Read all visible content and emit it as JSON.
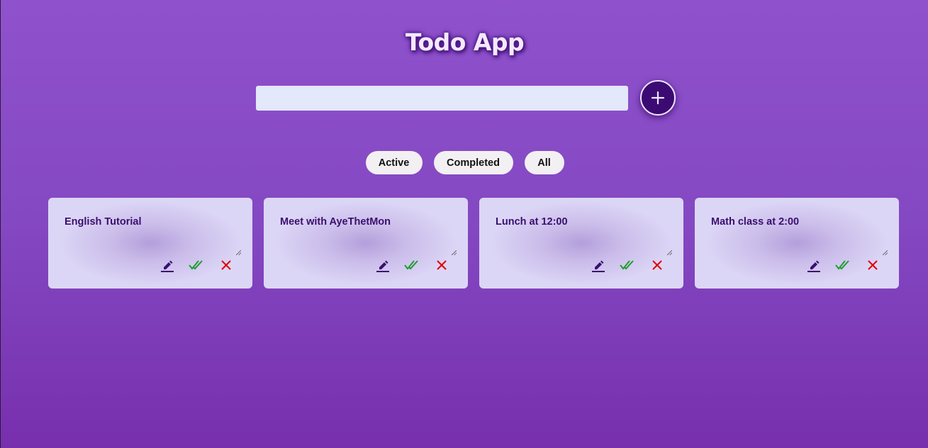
{
  "app": {
    "title": "Todo App"
  },
  "input": {
    "value": "",
    "placeholder": ""
  },
  "add_button": {
    "icon": "plus-icon"
  },
  "filters": [
    {
      "label": "Active"
    },
    {
      "label": "Completed"
    },
    {
      "label": "All"
    }
  ],
  "todos": [
    {
      "text": "English Tutorial"
    },
    {
      "text": "Meet with AyeThetMon"
    },
    {
      "text": "Lunch at 12:00"
    },
    {
      "text": "Math class at 2:00"
    }
  ],
  "icons": {
    "edit": "pencil-icon",
    "complete": "double-check-icon",
    "delete": "close-icon"
  },
  "colors": {
    "accent": "#3b0b73",
    "complete": "#1e9e2e",
    "delete": "#e00000",
    "edit": "#3a0f6e"
  }
}
